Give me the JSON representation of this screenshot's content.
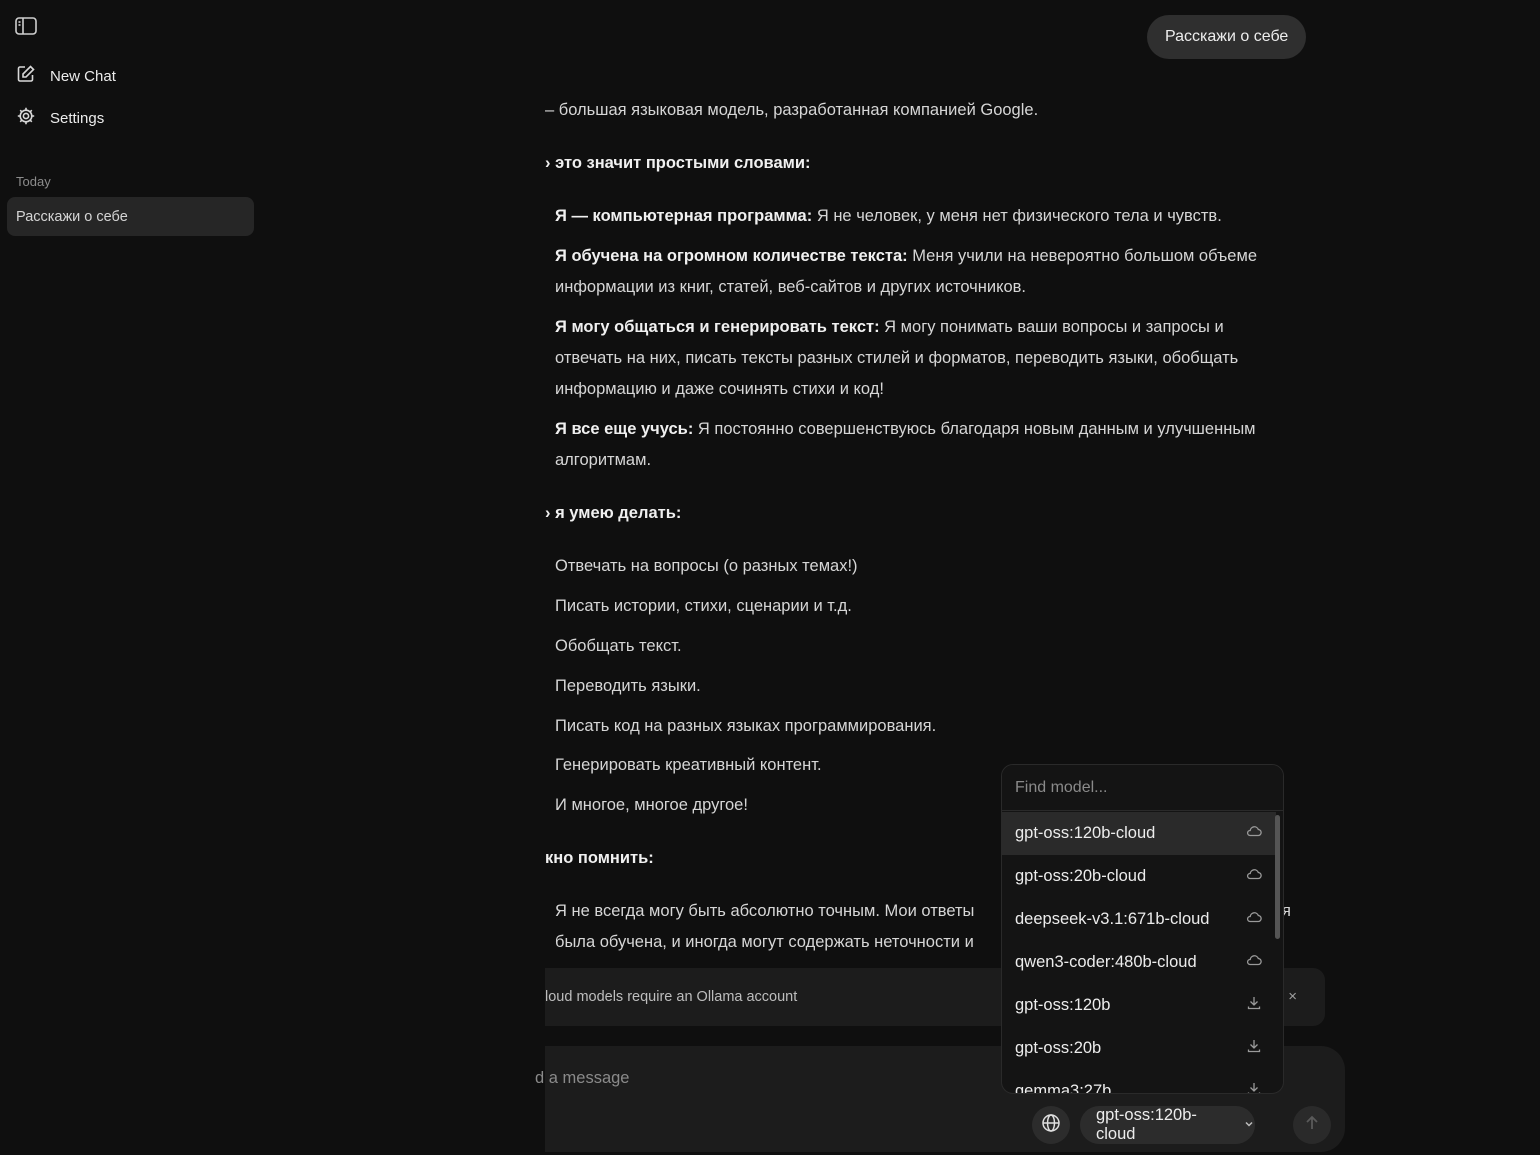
{
  "sidebar": {
    "new_chat": "New Chat",
    "settings": "Settings",
    "section_today": "Today",
    "chat_item": "Расскажи о себе"
  },
  "user_message": "Расскажи о себе",
  "assistant": {
    "intro": "– большая языковая модель, разработанная компанией Google.",
    "heading1": "› это значит простыми словами:",
    "points": [
      {
        "bold": "Я — компьютерная программа:",
        "text": " Я не человек, у меня нет физического тела и чувств."
      },
      {
        "bold": "Я обучена на огромном количестве текста:",
        "text": " Меня учили на невероятно большом объеме информации из книг, статей, веб-сайтов и других источников."
      },
      {
        "bold": "Я могу общаться и генерировать текст:",
        "text": " Я могу понимать ваши вопросы и запросы и отвечать на них, писать тексты разных стилей и форматов, переводить языки, обобщать информацию и даже сочинять стихи и код!"
      },
      {
        "bold": "Я все еще учусь:",
        "text": " Я постоянно совершенствуюсь благодаря новым данным и улучшенным алгоритмам."
      }
    ],
    "heading2": "› я умею делать:",
    "abilities": [
      "Отвечать на вопросы (о разных темах!)",
      "Писать истории, стихи, сценарии и т.д.",
      "Обобщать текст.",
      "Переводить языки.",
      "Писать код на разных языках программирования.",
      "Генерировать креативный контент.",
      "И многое, многое другое!"
    ],
    "heading3": "кно помнить:",
    "note_line1": "Я не всегда могу быть абсолютно точным. Мои ответы",
    "note_line1_tail": "я",
    "note_line2": "была обучена, и иногда могут содержать неточности и"
  },
  "banner": {
    "text": "loud models require an Ollama account",
    "close": "×"
  },
  "composer": {
    "placeholder": "d a message",
    "model": "gpt-oss:120b-cloud"
  },
  "dropdown": {
    "search_placeholder": "Find model...",
    "items": [
      {
        "name": "gpt-oss:120b-cloud",
        "icon": "cloud-icon"
      },
      {
        "name": "gpt-oss:20b-cloud",
        "icon": "cloud-icon"
      },
      {
        "name": "deepseek-v3.1:671b-cloud",
        "icon": "cloud-icon"
      },
      {
        "name": "qwen3-coder:480b-cloud",
        "icon": "cloud-icon"
      },
      {
        "name": "gpt-oss:120b",
        "icon": "download-icon"
      },
      {
        "name": "gpt-oss:20b",
        "icon": "download-icon"
      },
      {
        "name": "gemma3:27b",
        "icon": "download-icon"
      }
    ]
  },
  "colors": {
    "background": "#0f0f0f",
    "panel": "#1c1c1c",
    "active_item": "#2a2a2a",
    "text": "#e6e6e6"
  }
}
